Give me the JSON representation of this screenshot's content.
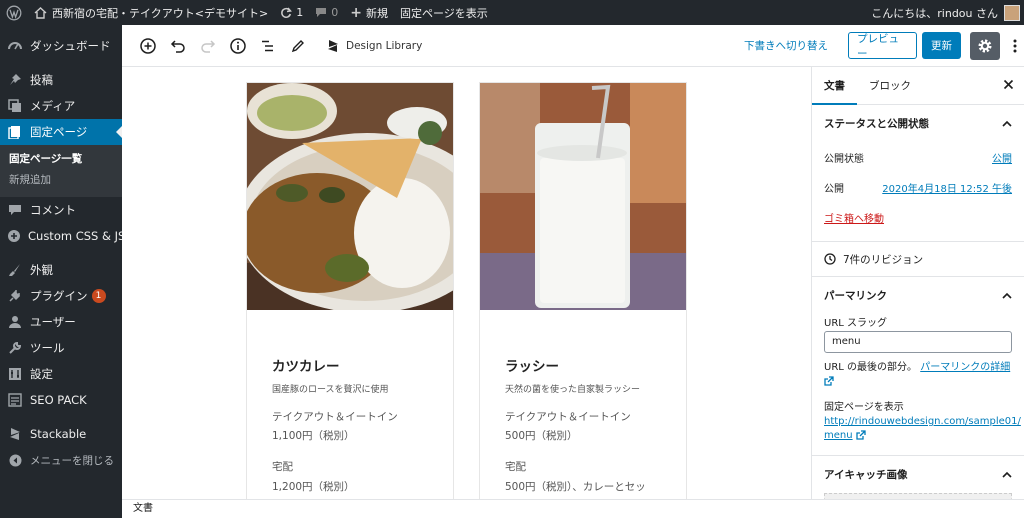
{
  "admin_bar": {
    "site_name": "西新宿の宅配・テイクアウト<デモサイト>",
    "updates_count": "1",
    "comments_count": "0",
    "new_label": "新規",
    "view_page_label": "固定ページを表示",
    "greeting": "こんにちは、rindou さん"
  },
  "sidebar": {
    "items": [
      {
        "label": "ダッシュボード",
        "icon": "dashboard-icon"
      },
      {
        "label": "投稿",
        "icon": "pin-icon"
      },
      {
        "label": "メディア",
        "icon": "media-icon"
      },
      {
        "label": "固定ページ",
        "icon": "page-icon"
      },
      {
        "label": "コメント",
        "icon": "comment-icon"
      },
      {
        "label": "Custom CSS & JS",
        "icon": "plus-circle-icon"
      },
      {
        "label": "外観",
        "icon": "brush-icon"
      },
      {
        "label": "プラグイン",
        "icon": "plugin-icon",
        "badge": "1"
      },
      {
        "label": "ユーザー",
        "icon": "user-icon"
      },
      {
        "label": "ツール",
        "icon": "wrench-icon"
      },
      {
        "label": "設定",
        "icon": "settings-icon"
      },
      {
        "label": "SEO PACK",
        "icon": "seo-icon"
      },
      {
        "label": "Stackable",
        "icon": "stackable-icon"
      },
      {
        "label": "メニューを閉じる",
        "icon": "collapse-icon"
      }
    ],
    "submenu": [
      "固定ページ一覧",
      "新規追加"
    ]
  },
  "toolbar": {
    "design_library": "Design Library",
    "switch_draft": "下書きへ切り替え",
    "preview": "プレビュー",
    "update": "更新"
  },
  "cards": [
    {
      "title": "カツカレー",
      "desc": "国産豚のロースを贅沢に使用",
      "line1": "テイクアウト＆イートイン",
      "line2": "1,100円（税別）",
      "line3": "宅配",
      "line4": "1,200円（税別）"
    },
    {
      "title": "ラッシー",
      "desc": "天然の菌を使った自家製ラッシー",
      "line1": "テイクアウト＆イートイン",
      "line2": "500円（税別）",
      "line3": "宅配",
      "line4": "500円（税別）、カレーとセッ"
    }
  ],
  "settings": {
    "tab_document": "文書",
    "tab_block": "ブロック",
    "status_title": "ステータスと公開状態",
    "visibility_label": "公開状態",
    "visibility_value": "公開",
    "publish_label": "公開",
    "publish_value": "2020年4月18日 12:52 午後",
    "trash_label": "ゴミ箱へ移動",
    "revisions": "7件のリビジョン",
    "permalink_title": "パーマリンク",
    "url_slug_label": "URL スラッグ",
    "url_slug_value": "menu",
    "url_note": "URL の最後の部分。",
    "permalink_detail_link": "パーマリンクの詳細",
    "view_page_label": "固定ページを表示",
    "page_url": "http://rindouwebdesign.com/sample01/",
    "page_url_tail": "menu",
    "featured_image_title": "アイキャッチ画像"
  },
  "footer": {
    "breadcrumb": "文書"
  },
  "colors": {
    "accent": "#007cba",
    "admin_dark": "#23282d",
    "current_menu": "#0073aa",
    "trash": "#cc1818"
  }
}
